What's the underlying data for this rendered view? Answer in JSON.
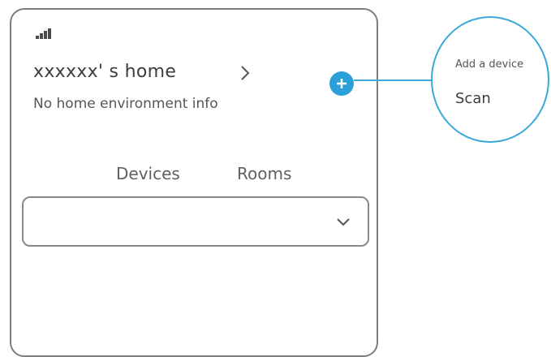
{
  "home": {
    "title": "xxxxxx' s  home",
    "environment_info": "No home environment info"
  },
  "tabs": [
    {
      "label": "Devices"
    },
    {
      "label": "Rooms"
    }
  ],
  "callout": {
    "add_device_label": "Add a device",
    "scan_label": "Scan"
  },
  "icons": {
    "signal": "signal-bars-icon",
    "home_chevron": "chevron-right-icon",
    "add": "plus-circle-icon",
    "dropdown": "chevron-down-icon"
  },
  "colors": {
    "accent": "#2a9fd8",
    "callout_line": "#3aa8d8",
    "frame": "#7d7d7d"
  }
}
